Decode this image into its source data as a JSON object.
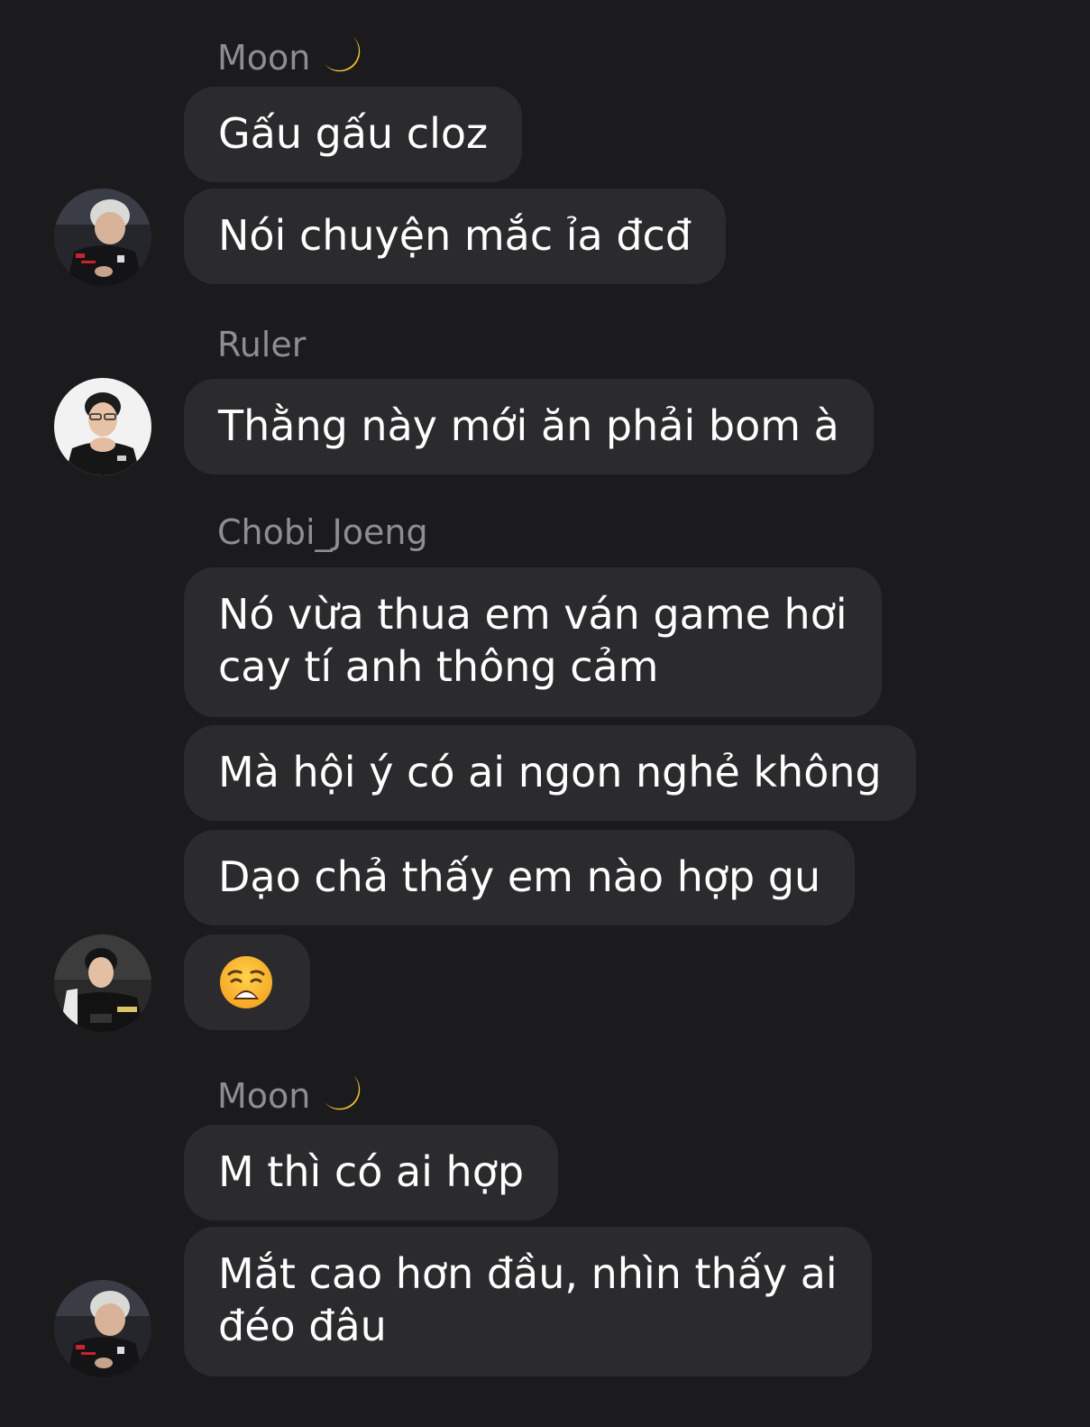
{
  "groups": [
    {
      "sender": "Moon",
      "sender_icon": "crescent-moon-icon",
      "messages": [
        {
          "lines": [
            "Gấu gấu cloz"
          ]
        },
        {
          "lines": [
            "Nói chuyện mắc ỉa đcđ"
          ]
        }
      ],
      "avatar": "avatar-moon"
    },
    {
      "sender": "Ruler",
      "messages": [
        {
          "lines": [
            "Thằng này mới ăn phải bom à"
          ]
        }
      ],
      "avatar": "avatar-ruler"
    },
    {
      "sender": "Chobi_Joeng",
      "messages": [
        {
          "lines": [
            "Nó vừa thua em ván game hơi",
            "cay tí anh thông cảm"
          ]
        },
        {
          "lines": [
            "Mà hội ý có ai ngon nghẻ không"
          ]
        },
        {
          "lines": [
            "Dạo chả thấy em nào hợp gu"
          ]
        },
        {
          "emoji": "weary-face-emoji"
        }
      ],
      "avatar": "avatar-chobi"
    },
    {
      "sender": "Moon",
      "sender_icon": "crescent-moon-icon",
      "messages": [
        {
          "lines": [
            "M thì có ai hợp"
          ]
        },
        {
          "lines": [
            "Mắt cao hơn đầu, nhìn thấy ai",
            "đéo đâu"
          ]
        }
      ],
      "avatar": "avatar-moon"
    }
  ],
  "colors": {
    "background": "#1b1b1d",
    "bubble": "#2b2b2e",
    "sender_text": "#8d8d92",
    "message_text": "#ffffff"
  }
}
